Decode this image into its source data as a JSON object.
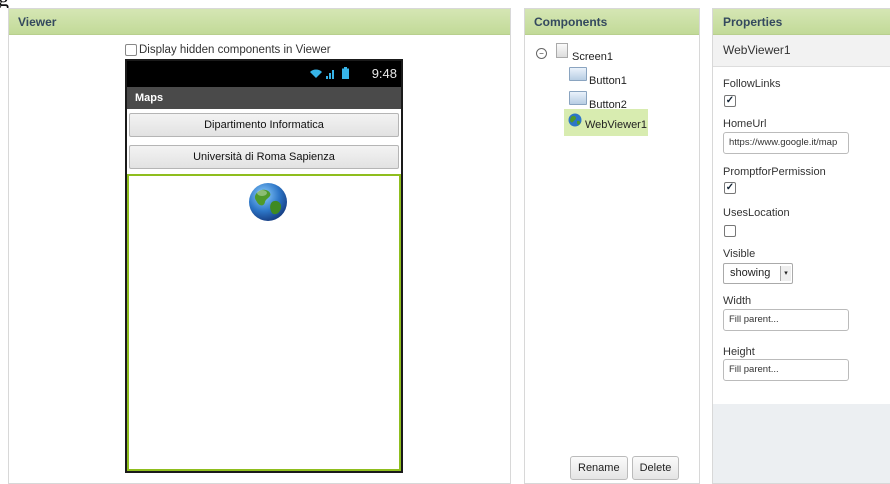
{
  "viewer": {
    "header": "Viewer",
    "hidden_components_label": "Display hidden components in Viewer",
    "hidden_components_checked": false,
    "phone": {
      "time": "9:48",
      "title": "Maps",
      "button1_text": "Dipartimento Informatica",
      "button2_text": "Università di Roma Sapienza",
      "webviewer_icon": "globe-icon"
    }
  },
  "components": {
    "header": "Components",
    "tree": {
      "root": "Screen1",
      "children": [
        "Button1",
        "Button2",
        "WebViewer1"
      ],
      "selected": "WebViewer1"
    },
    "rename_label": "Rename",
    "delete_label": "Delete"
  },
  "properties": {
    "header": "Properties",
    "component_name": "WebViewer1",
    "follow_links": {
      "label": "FollowLinks",
      "checked": true
    },
    "home_url": {
      "label": "HomeUrl",
      "value": "https://www.google.it/map"
    },
    "prompt_for_permission": {
      "label": "PromptforPermission",
      "checked": true
    },
    "uses_location": {
      "label": "UsesLocation",
      "checked": false
    },
    "visible": {
      "label": "Visible",
      "value": "showing"
    },
    "width": {
      "label": "Width",
      "value": "Fill parent..."
    },
    "height": {
      "label": "Height",
      "value": "Fill parent..."
    }
  },
  "colors": {
    "header_green": "#c2da98",
    "selection_green": "#d8ecb0",
    "webviewer_border": "#8fbe1e"
  }
}
